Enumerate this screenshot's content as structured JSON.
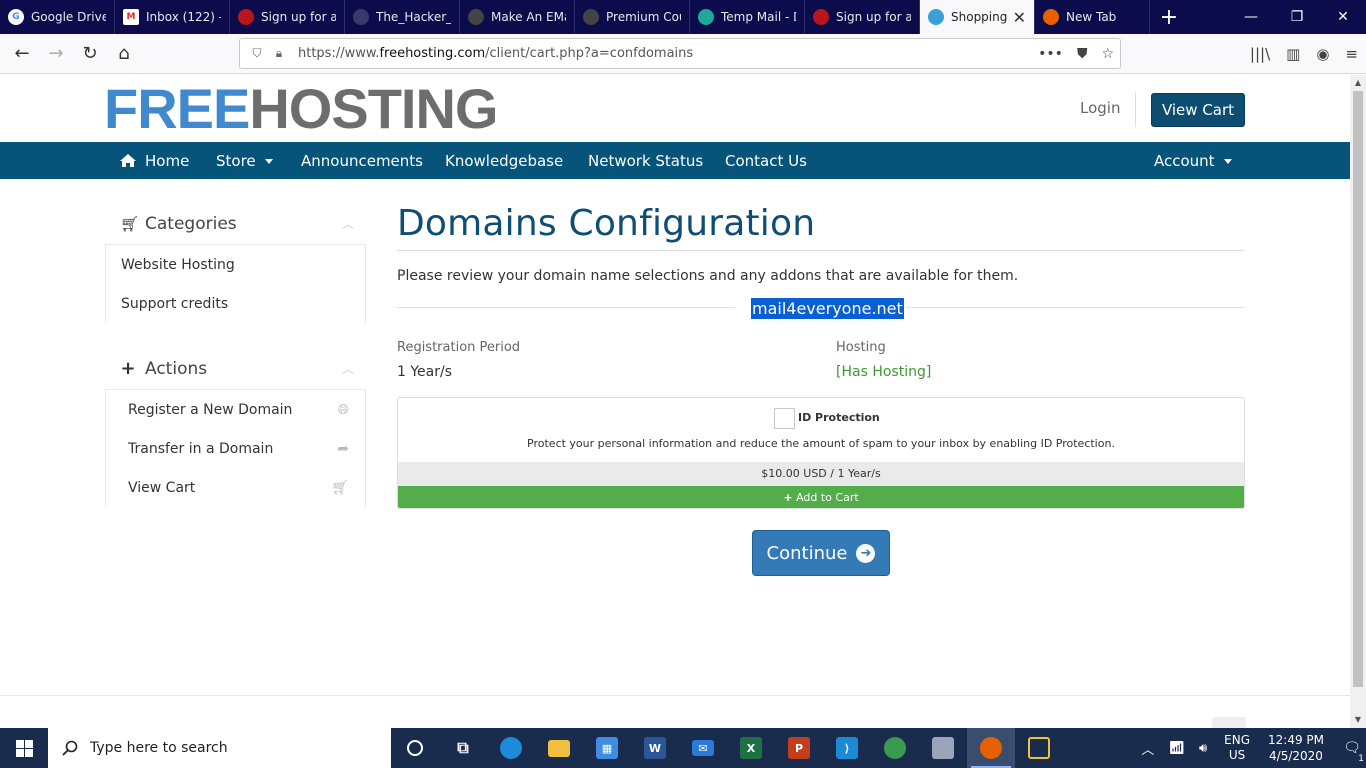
{
  "browser": {
    "tabs": [
      {
        "label": "Google Drive",
        "favicon_color": "#3c8ce7",
        "favicon_text": "G"
      },
      {
        "label": "Inbox (122) -",
        "favicon_color": "#d93025",
        "favicon_text": "M"
      },
      {
        "label": "Sign up for a f",
        "favicon_color": "#b8151c",
        "favicon_text": ""
      },
      {
        "label": "The_Hacker_s_Und",
        "favicon_color": "#0c0c4c",
        "favicon_text": ""
      },
      {
        "label": "Make An EMa",
        "favicon_color": "#222222",
        "favicon_text": ""
      },
      {
        "label": "Premium Cou",
        "favicon_color": "#222222",
        "favicon_text": ""
      },
      {
        "label": "Temp Mail - D",
        "favicon_color": "#1ea79a",
        "favicon_text": ""
      },
      {
        "label": "Sign up for a f",
        "favicon_color": "#b8151c",
        "favicon_text": ""
      },
      {
        "label": "Shopping",
        "favicon_color": "#3aa0d8",
        "favicon_text": "",
        "active": true
      },
      {
        "label": "New Tab",
        "favicon_color": "#e66000",
        "favicon_text": ""
      }
    ],
    "url_prefix": "https://www.",
    "url_domain": "freehosting.com",
    "url_path": "/client/cart.php?a=confdomains"
  },
  "header": {
    "logo_free": "FREE",
    "logo_hosting": "HOSTING",
    "login_label": "Login",
    "view_cart_label": "View Cart"
  },
  "nav": {
    "home": "Home",
    "store": "Store",
    "announcements": "Announcements",
    "knowledgebase": "Knowledgebase",
    "network_status": "Network Status",
    "contact_us": "Contact Us",
    "account": "Account"
  },
  "sidebar": {
    "categories_title": "Categories",
    "categories": [
      "Website Hosting",
      "Support credits"
    ],
    "actions_title": "Actions",
    "actions": [
      "Register a New Domain",
      "Transfer in a Domain",
      "View Cart"
    ]
  },
  "main": {
    "title": "Domains Configuration",
    "intro": "Please review your domain name selections and any addons that are available for them.",
    "domain": "mail4everyone.net",
    "registration_label": "Registration Period",
    "registration_value": "1 Year/s",
    "hosting_label": "Hosting",
    "hosting_value": "[Has Hosting]",
    "hosting_color": "#3c9a2f",
    "addon": {
      "name": "ID Protection",
      "description": "Protect your personal information and reduce the amount of spam to your inbox by enabling ID Protection.",
      "price": "$10.00 USD / 1 Year/s",
      "add_label": "Add to Cart"
    },
    "continue_label": "Continue"
  },
  "taskbar": {
    "search_placeholder": "Type here to search",
    "lang_line1": "ENG",
    "lang_line2": "US",
    "time": "12:49 PM",
    "date": "4/5/2020",
    "notification_count": "1"
  }
}
